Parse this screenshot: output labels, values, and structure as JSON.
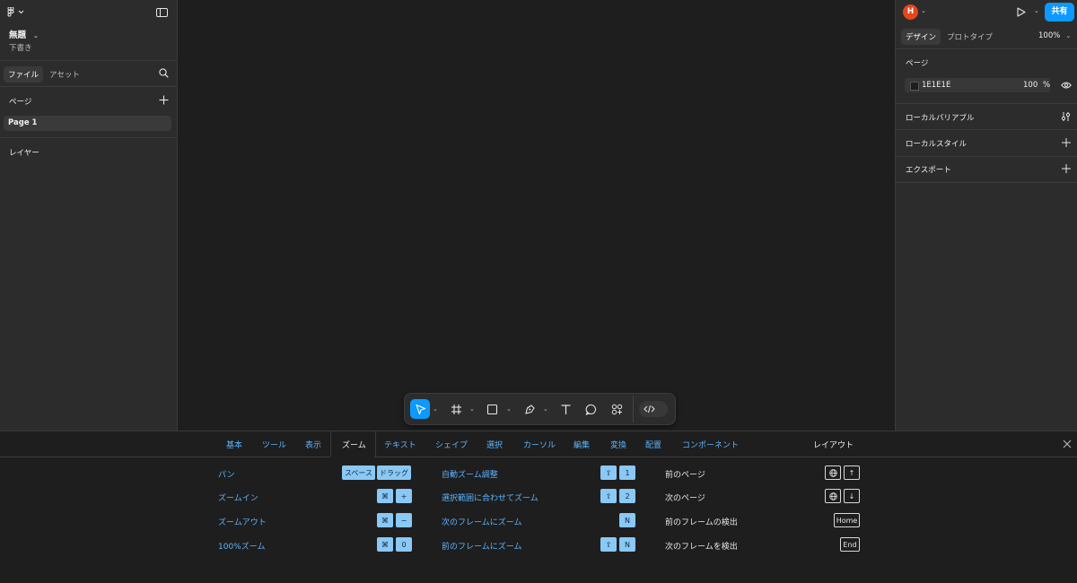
{
  "file": {
    "title": "無題",
    "subtitle": "下書き"
  },
  "left_panel": {
    "tabs": [
      "ファイル",
      "アセット"
    ],
    "pages_header": "ページ",
    "pages": [
      "Page 1"
    ],
    "layers_header": "レイヤー"
  },
  "right_panel": {
    "avatar_letter": "H",
    "share_label": "共有",
    "tabs": [
      "デザイン",
      "プロトタイプ"
    ],
    "zoom": "100%",
    "page_section": "ページ",
    "bg_color_hex": "1E1E1E",
    "bg_opacity": "100",
    "percent": "%",
    "sections": [
      "ローカルバリアブル",
      "ローカルスタイル",
      "エクスポート"
    ]
  },
  "shortcuts": {
    "tabs": [
      "基本",
      "ツール",
      "表示",
      "ズーム",
      "テキスト",
      "シェイプ",
      "選択",
      "カーソル",
      "編集",
      "変換",
      "配置",
      "コンポーネント",
      "レイアウト"
    ],
    "col1": [
      {
        "label": "パン",
        "keys": [
          "スペース",
          "ドラッグ"
        ]
      },
      {
        "label": "ズームイン",
        "keys": [
          "⌘",
          "+"
        ]
      },
      {
        "label": "ズームアウト",
        "keys": [
          "⌘",
          "−"
        ]
      },
      {
        "label": "100%ズーム",
        "keys": [
          "⌘",
          "0"
        ]
      }
    ],
    "col2": [
      {
        "label": "自動ズーム調整",
        "keys": [
          "⇧",
          "1"
        ]
      },
      {
        "label": "選択範囲に合わせてズーム",
        "keys": [
          "⇧",
          "2"
        ]
      },
      {
        "label": "次のフレームにズーム",
        "keys": [
          "N"
        ]
      },
      {
        "label": "前のフレームにズーム",
        "keys": [
          "⇧",
          "N"
        ]
      }
    ],
    "col3": [
      {
        "label": "前のページ",
        "keys": [
          "🌐",
          "↑"
        ]
      },
      {
        "label": "次のページ",
        "keys": [
          "🌐",
          "↓"
        ]
      },
      {
        "label": "前のフレームの検出",
        "keys": [
          "Home"
        ]
      },
      {
        "label": "次のフレームを検出",
        "keys": [
          "End"
        ]
      }
    ]
  },
  "colors": {
    "accent": "#0d99ff",
    "avatar": "#e5461b",
    "key_bg": "#8ac8f5",
    "link": "#5db4ff"
  },
  "icons": {
    "logo": "figma-logo-icon",
    "sidebar_toggle": "sidebar-toggle-icon",
    "search": "search-icon",
    "add": "plus-icon",
    "play": "play-icon",
    "eye": "eye-icon",
    "variables": "sliders-icon",
    "close": "close-icon"
  }
}
